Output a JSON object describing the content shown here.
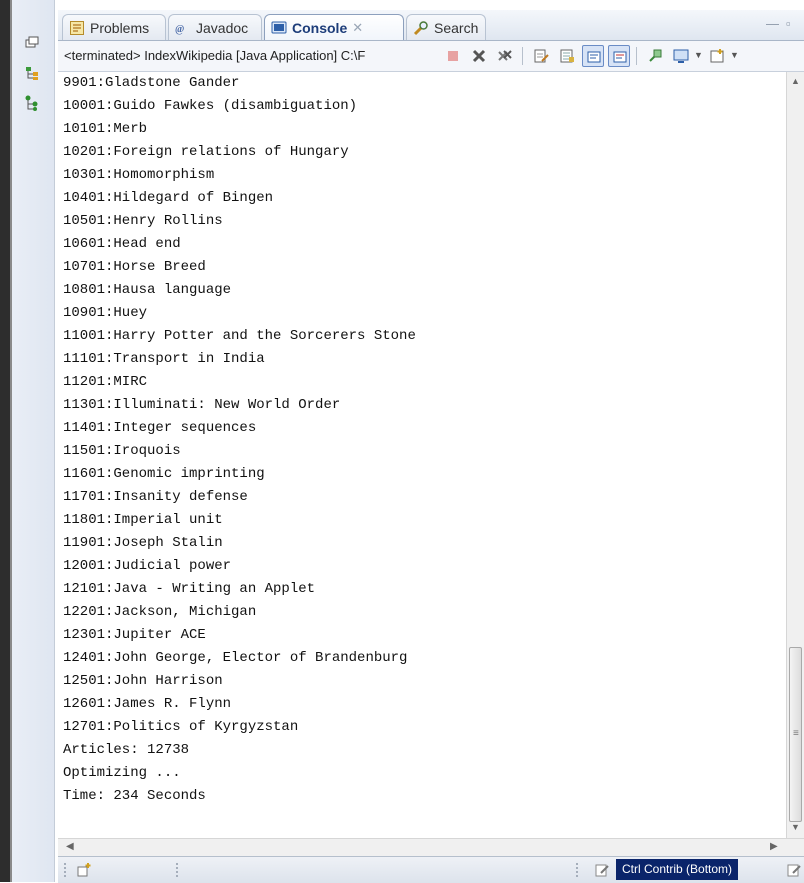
{
  "tabs": [
    {
      "label": "Problems",
      "icon": "problems-icon",
      "active": false
    },
    {
      "label": "Javadoc",
      "icon": "javadoc-icon",
      "active": false
    },
    {
      "label": "Console",
      "icon": "console-icon",
      "active": true
    },
    {
      "label": "Search",
      "icon": "search-icon",
      "active": false
    }
  ],
  "console": {
    "status": "<terminated> IndexWikipedia [Java Application] C:\\F",
    "lines": [
      "9901:Gladstone Gander",
      "10001:Guido Fawkes (disambiguation)",
      "10101:Merb",
      "10201:Foreign relations of Hungary",
      "10301:Homomorphism",
      "10401:Hildegard of Bingen",
      "10501:Henry Rollins",
      "10601:Head end",
      "10701:Horse Breed",
      "10801:Hausa language",
      "10901:Huey",
      "11001:Harry Potter and the Sorcerers Stone",
      "11101:Transport in India",
      "11201:MIRC",
      "11301:Illuminati: New World Order",
      "11401:Integer sequences",
      "11501:Iroquois",
      "11601:Genomic imprinting",
      "11701:Insanity defense",
      "11801:Imperial unit",
      "11901:Joseph Stalin",
      "12001:Judicial power",
      "12101:Java - Writing an Applet",
      "12201:Jackson, Michigan",
      "12301:Jupiter ACE",
      "12401:John George, Elector of Brandenburg",
      "12501:John Harrison",
      "12601:James R. Flynn",
      "12701:Politics of Kyrgyzstan",
      "Articles: 12738",
      "Optimizing ...",
      "Time: 234 Seconds"
    ]
  },
  "status_bar": {
    "contribution_label": "Ctrl Contrib (Bottom)"
  },
  "colors": {
    "active_tab_text": "#1d3d7a",
    "contrib_background": "#0a246a"
  }
}
